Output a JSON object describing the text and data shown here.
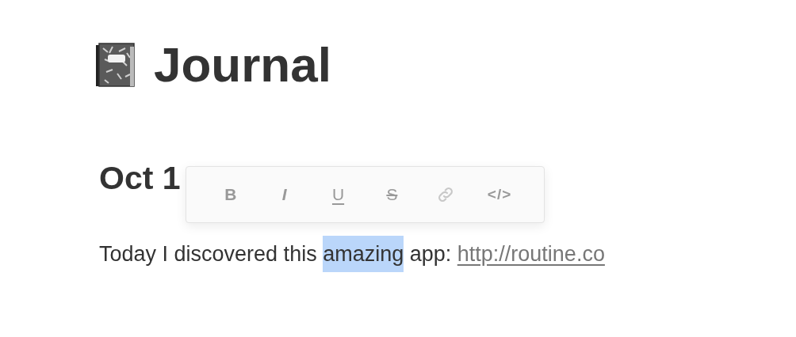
{
  "page": {
    "title": "Journal"
  },
  "entry": {
    "heading": "Oct 1",
    "segments": [
      {
        "text": "Today I discovered this ",
        "selected": false
      },
      {
        "text": "amazing",
        "selected": true
      },
      {
        "text": " app: ",
        "selected": false
      }
    ],
    "link": "http://routine.co"
  },
  "format_toolbar": {
    "buttons": [
      {
        "kind": "bold",
        "label": "B",
        "disabled": false
      },
      {
        "kind": "italic",
        "label": "I",
        "disabled": false
      },
      {
        "kind": "underline",
        "label": "U",
        "disabled": false
      },
      {
        "kind": "strike",
        "label": "S",
        "disabled": false
      },
      {
        "kind": "link",
        "disabled": true
      },
      {
        "kind": "code",
        "label": "</>",
        "disabled": false
      }
    ]
  }
}
